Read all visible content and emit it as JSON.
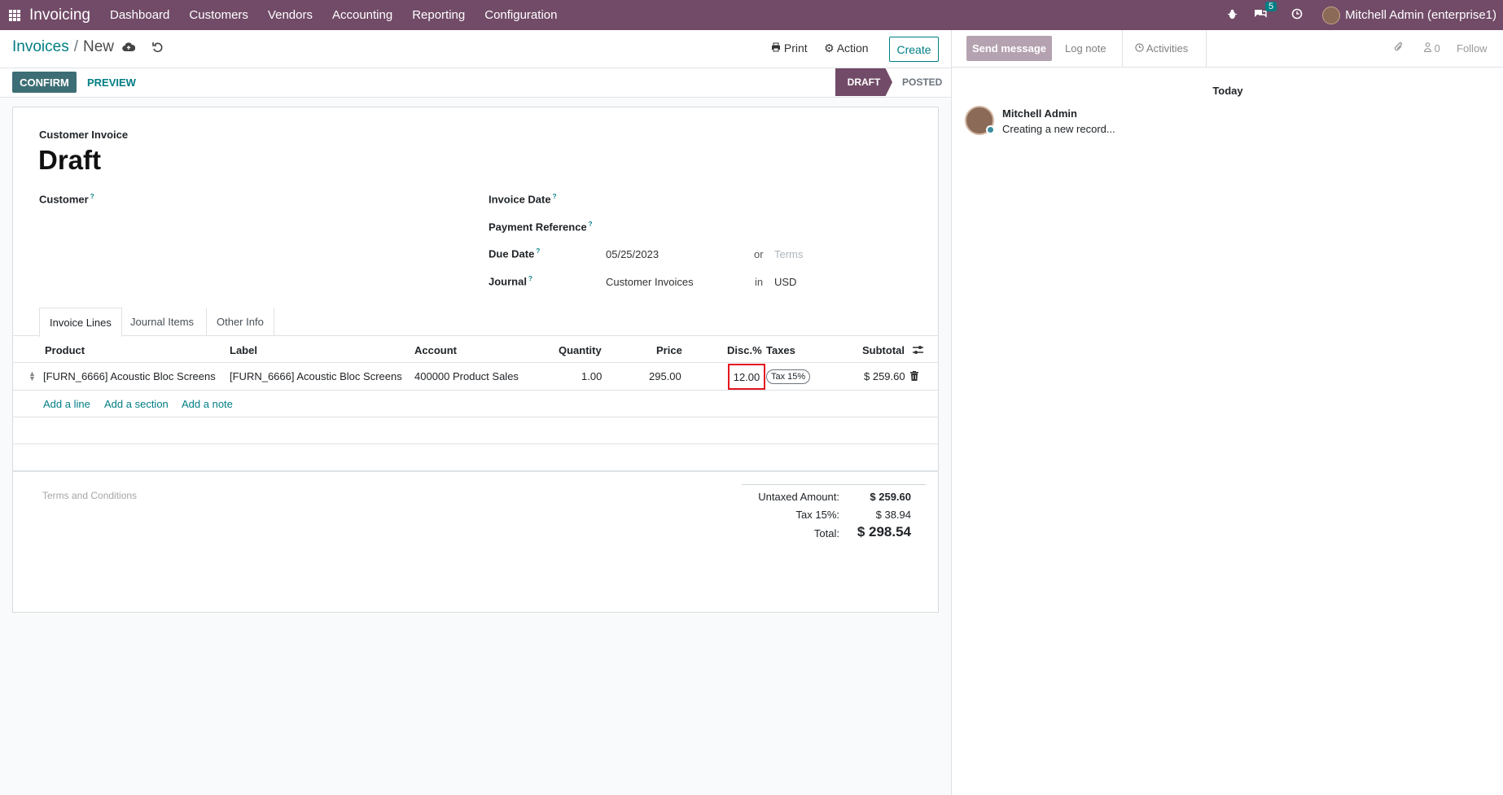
{
  "navbar": {
    "app_name": "Invoicing",
    "menu": [
      "Dashboard",
      "Customers",
      "Vendors",
      "Accounting",
      "Reporting",
      "Configuration"
    ],
    "message_count": "5",
    "user": "Mitchell Admin (enterprise1)"
  },
  "control_panel": {
    "breadcrumb_parent": "Invoices",
    "breadcrumb_current": "New",
    "print_label": "Print",
    "action_label": "Action",
    "create_label": "Create"
  },
  "statusbar": {
    "confirm_label": "CONFIRM",
    "preview_label": "PREVIEW",
    "stage_draft": "DRAFT",
    "stage_posted": "POSTED"
  },
  "form": {
    "doc_type": "Customer Invoice",
    "title": "Draft",
    "customer_label": "Customer",
    "invoice_date_label": "Invoice Date",
    "payment_ref_label": "Payment Reference",
    "due_date_label": "Due Date",
    "due_date_value": "05/25/2023",
    "or_text": "or",
    "terms_placeholder": "Terms",
    "journal_label": "Journal",
    "journal_value": "Customer Invoices",
    "in_text": "in",
    "currency": "USD",
    "help_marker": "?"
  },
  "tabs": [
    "Invoice Lines",
    "Journal Items",
    "Other Info"
  ],
  "table": {
    "headers": [
      "Product",
      "Label",
      "Account",
      "Quantity",
      "Price",
      "Disc.%",
      "Taxes",
      "Subtotal"
    ],
    "rows": [
      {
        "product": "[FURN_6666] Acoustic Bloc Screens",
        "label": "[FURN_6666] Acoustic Bloc Screens",
        "account": "400000 Product Sales",
        "quantity": "1.00",
        "price": "295.00",
        "discount": "12.00",
        "tax": "Tax 15%",
        "subtotal": "$ 259.60"
      }
    ],
    "add_line": "Add a line",
    "add_section": "Add a section",
    "add_note": "Add a note"
  },
  "footer": {
    "terms_placeholder": "Terms and Conditions",
    "untaxed_label": "Untaxed Amount:",
    "untaxed_value": "$ 259.60",
    "tax_label": "Tax 15%:",
    "tax_value": "$ 38.94",
    "total_label": "Total:",
    "total_value": "$ 298.54"
  },
  "chatter": {
    "send_message": "Send message",
    "log_note": "Log note",
    "activities": "Activities",
    "follower_count": "0",
    "follow": "Follow",
    "date_separator": "Today",
    "author": "Mitchell Admin",
    "message": "Creating a new record..."
  },
  "colors": {
    "brand": "#714b67",
    "accent": "#017e84",
    "confirm": "#3d6e75",
    "highlight_box": "#e4141d"
  }
}
